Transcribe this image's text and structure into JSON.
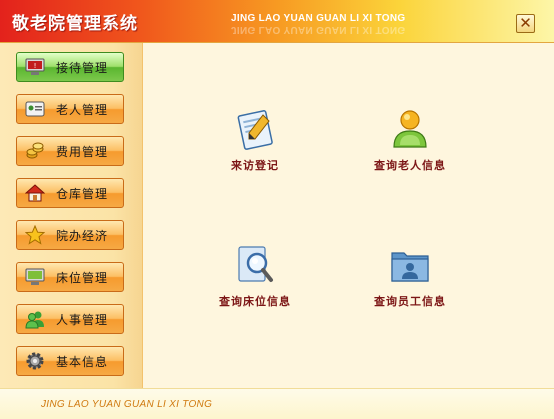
{
  "window": {
    "title": "敬老院管理系统",
    "subtitle": "JING LAO YUAN GUAN LI XI TONG",
    "close_icon": "close-icon"
  },
  "sidebar": {
    "items": [
      {
        "label": "接待管理",
        "icon": "reception-monitor-icon",
        "active": true
      },
      {
        "label": "老人管理",
        "icon": "id-card-icon",
        "active": false
      },
      {
        "label": "费用管理",
        "icon": "coins-icon",
        "active": false
      },
      {
        "label": "仓库管理",
        "icon": "house-icon",
        "active": false
      },
      {
        "label": "院办经济",
        "icon": "star-icon",
        "active": false
      },
      {
        "label": "床位管理",
        "icon": "bed-monitor-icon",
        "active": false
      },
      {
        "label": "人事管理",
        "icon": "people-icon",
        "active": false
      },
      {
        "label": "基本信息",
        "icon": "gear-icon",
        "active": false
      }
    ]
  },
  "main": {
    "tiles": [
      {
        "label": "来访登记",
        "icon": "visit-register-icon"
      },
      {
        "label": "查询老人信息",
        "icon": "person-icon"
      },
      {
        "label": "查询床位信息",
        "icon": "magnifier-document-icon"
      },
      {
        "label": "查询员工信息",
        "icon": "employee-folder-icon"
      }
    ]
  },
  "footer": {
    "text": "JING LAO YUAN GUAN LI XI TONG"
  },
  "colors": {
    "title_gradient_start": "#e3221c",
    "title_gradient_end": "#fdf6a8",
    "nav_orange": "#f69b2e",
    "nav_active_green": "#5ab62f",
    "tile_label": "#7c1616",
    "footer_text": "#d07a10"
  }
}
